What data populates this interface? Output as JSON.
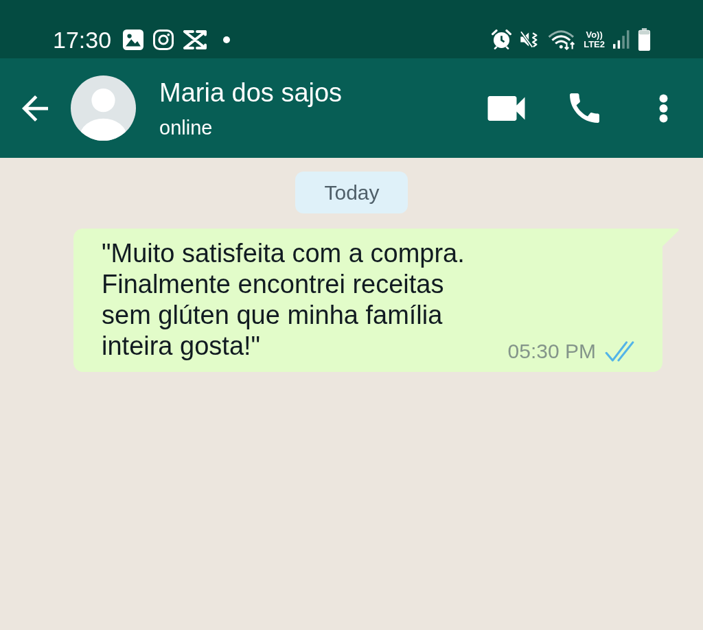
{
  "status_bar": {
    "time": "17:30",
    "volte": "Vo))",
    "network": "LTE2"
  },
  "chat_header": {
    "contact_name": "Maria dos sajos",
    "status": "online"
  },
  "messages": [
    {
      "kind": "date",
      "text": "Today"
    },
    {
      "kind": "outgoing",
      "text": "\"Muito satisfeita com a compra.\nFinalmente encontrei receitas\nsem glúten que minha família\ninteira gosta!\"",
      "time": "05:30 PM",
      "read": true
    }
  ]
}
